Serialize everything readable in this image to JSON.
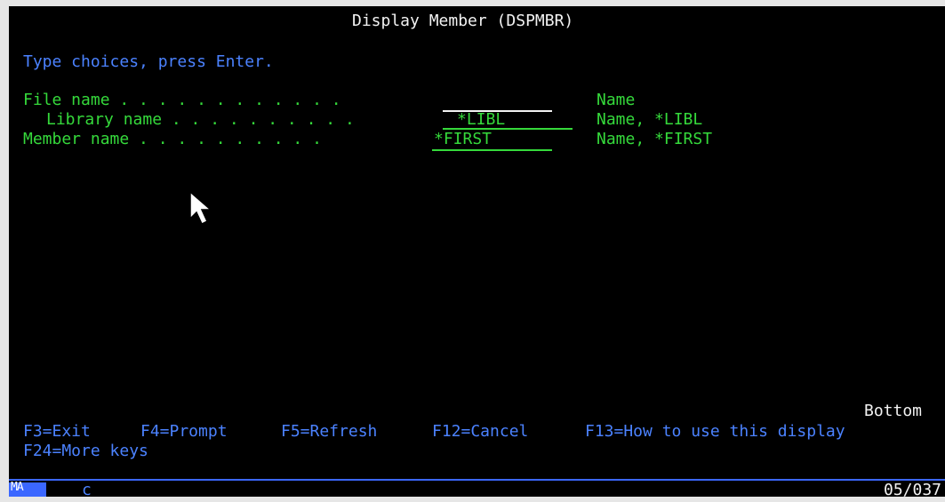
{
  "screen_title": "Display Member (DSPMBR)",
  "instruction": "Type choices, press Enter.",
  "fields": {
    "file_name": {
      "label": "File name . . . . . . . . . . . .",
      "value": "",
      "help": "Name"
    },
    "library_name": {
      "label": "Library name . . . . . . . . . .",
      "value": "*LIBL",
      "help": "Name, *LIBL"
    },
    "member_name": {
      "label": "Member name . . . . . . . . . .",
      "value": "*FIRST",
      "help": "Name, *FIRST"
    }
  },
  "footer": {
    "position_text": "Bottom",
    "row1": [
      "F3=Exit",
      "F4=Prompt",
      "F5=Refresh",
      "F12=Cancel",
      "F13=How to use this display"
    ],
    "row2": [
      "F24=More keys"
    ]
  },
  "status_bar": {
    "mode_indicator": "MA",
    "session_char": "c",
    "cursor_pos": "05/037"
  },
  "colors": {
    "background": "#000000",
    "text_green": "#35d93b",
    "text_blue": "#4b82ff",
    "text_white": "#f2f2f2",
    "status_blue": "#3b67ff"
  },
  "icons": {
    "mouse_pointer": "mouse-pointer-icon"
  }
}
